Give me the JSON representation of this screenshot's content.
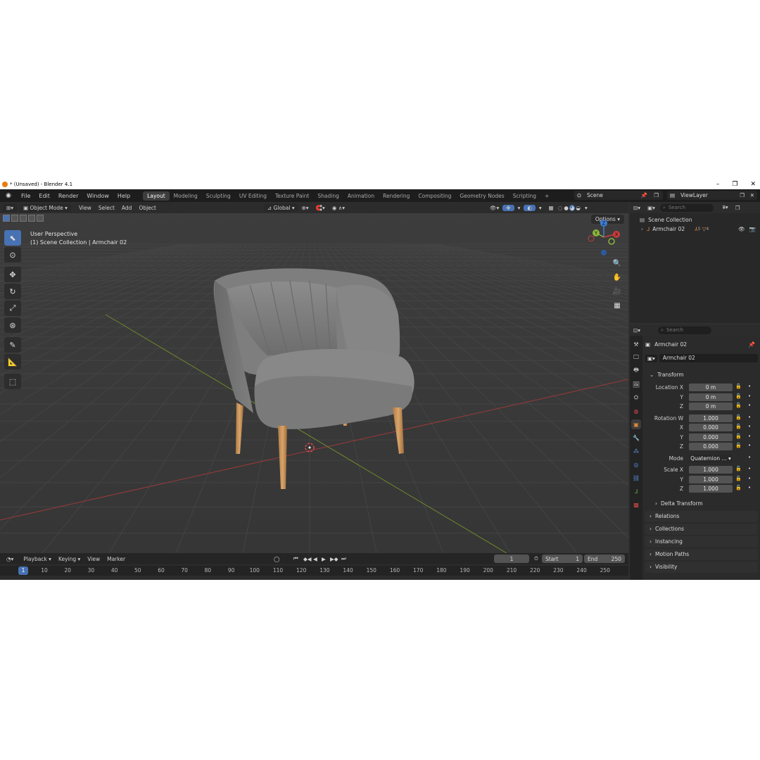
{
  "window": {
    "title": "* (Unsaved) - Blender 4.1",
    "minimize": "–",
    "restore": "❐",
    "close": "✕"
  },
  "menu": [
    "File",
    "Edit",
    "Render",
    "Window",
    "Help"
  ],
  "workspaces": [
    "Layout",
    "Modeling",
    "Sculpting",
    "UV Editing",
    "Texture Paint",
    "Shading",
    "Animation",
    "Rendering",
    "Compositing",
    "Geometry Nodes",
    "Scripting",
    "+"
  ],
  "active_workspace": "Layout",
  "scene": {
    "name": "Scene",
    "view_layer": "ViewLayer"
  },
  "viewport": {
    "mode": "Object Mode",
    "menus": [
      "View",
      "Select",
      "Add",
      "Object"
    ],
    "transform_orientation": "Global",
    "options": "Options",
    "perspective": "User Perspective",
    "collection_info": "(1) Scene Collection | Armchair 02",
    "gizmo": {
      "z": "Z",
      "y": "Y",
      "x": "X"
    }
  },
  "timeline": {
    "menus": [
      "Playback",
      "Keying",
      "View",
      "Marker"
    ],
    "current_frame": "1",
    "start_label": "Start",
    "start": "1",
    "end_label": "End",
    "end": "250",
    "ticks": [
      "1",
      "10",
      "20",
      "30",
      "40",
      "50",
      "60",
      "70",
      "80",
      "90",
      "100",
      "110",
      "120",
      "130",
      "140",
      "150",
      "160",
      "170",
      "180",
      "190",
      "200",
      "210",
      "220",
      "230",
      "240",
      "250"
    ]
  },
  "outliner": {
    "search_placeholder": "Search",
    "root": "Scene Collection",
    "items": [
      {
        "name": "Armchair 02",
        "modifiers": "5",
        "mesh": "4"
      }
    ]
  },
  "properties": {
    "search_placeholder": "Search",
    "object_name": "Armchair 02",
    "data_name": "Armchair 02",
    "transform_title": "Transform",
    "location": {
      "label": "Location X",
      "x": "0 m",
      "y": "0 m",
      "z": "0 m"
    },
    "rotation": {
      "label": "Rotation W",
      "w": "1.000",
      "x": "0.000",
      "y": "0.000",
      "z": "0.000"
    },
    "mode": {
      "label": "Mode",
      "value": "Quaternion ..."
    },
    "scale": {
      "label": "Scale X",
      "x": "1.000",
      "y": "1.000",
      "z": "1.000"
    },
    "axis_labels": {
      "x": "X",
      "y": "Y",
      "z": "Z"
    },
    "delta_transform": "Delta Transform",
    "panels": [
      "Relations",
      "Collections",
      "Instancing",
      "Motion Paths",
      "Visibility"
    ]
  },
  "colors": {
    "accent": "#4772b3",
    "blender_orange": "#e87d0d",
    "x_axis": "#cc3b3b",
    "y_axis": "#8ab53b",
    "z_axis": "#3d7fd6"
  }
}
